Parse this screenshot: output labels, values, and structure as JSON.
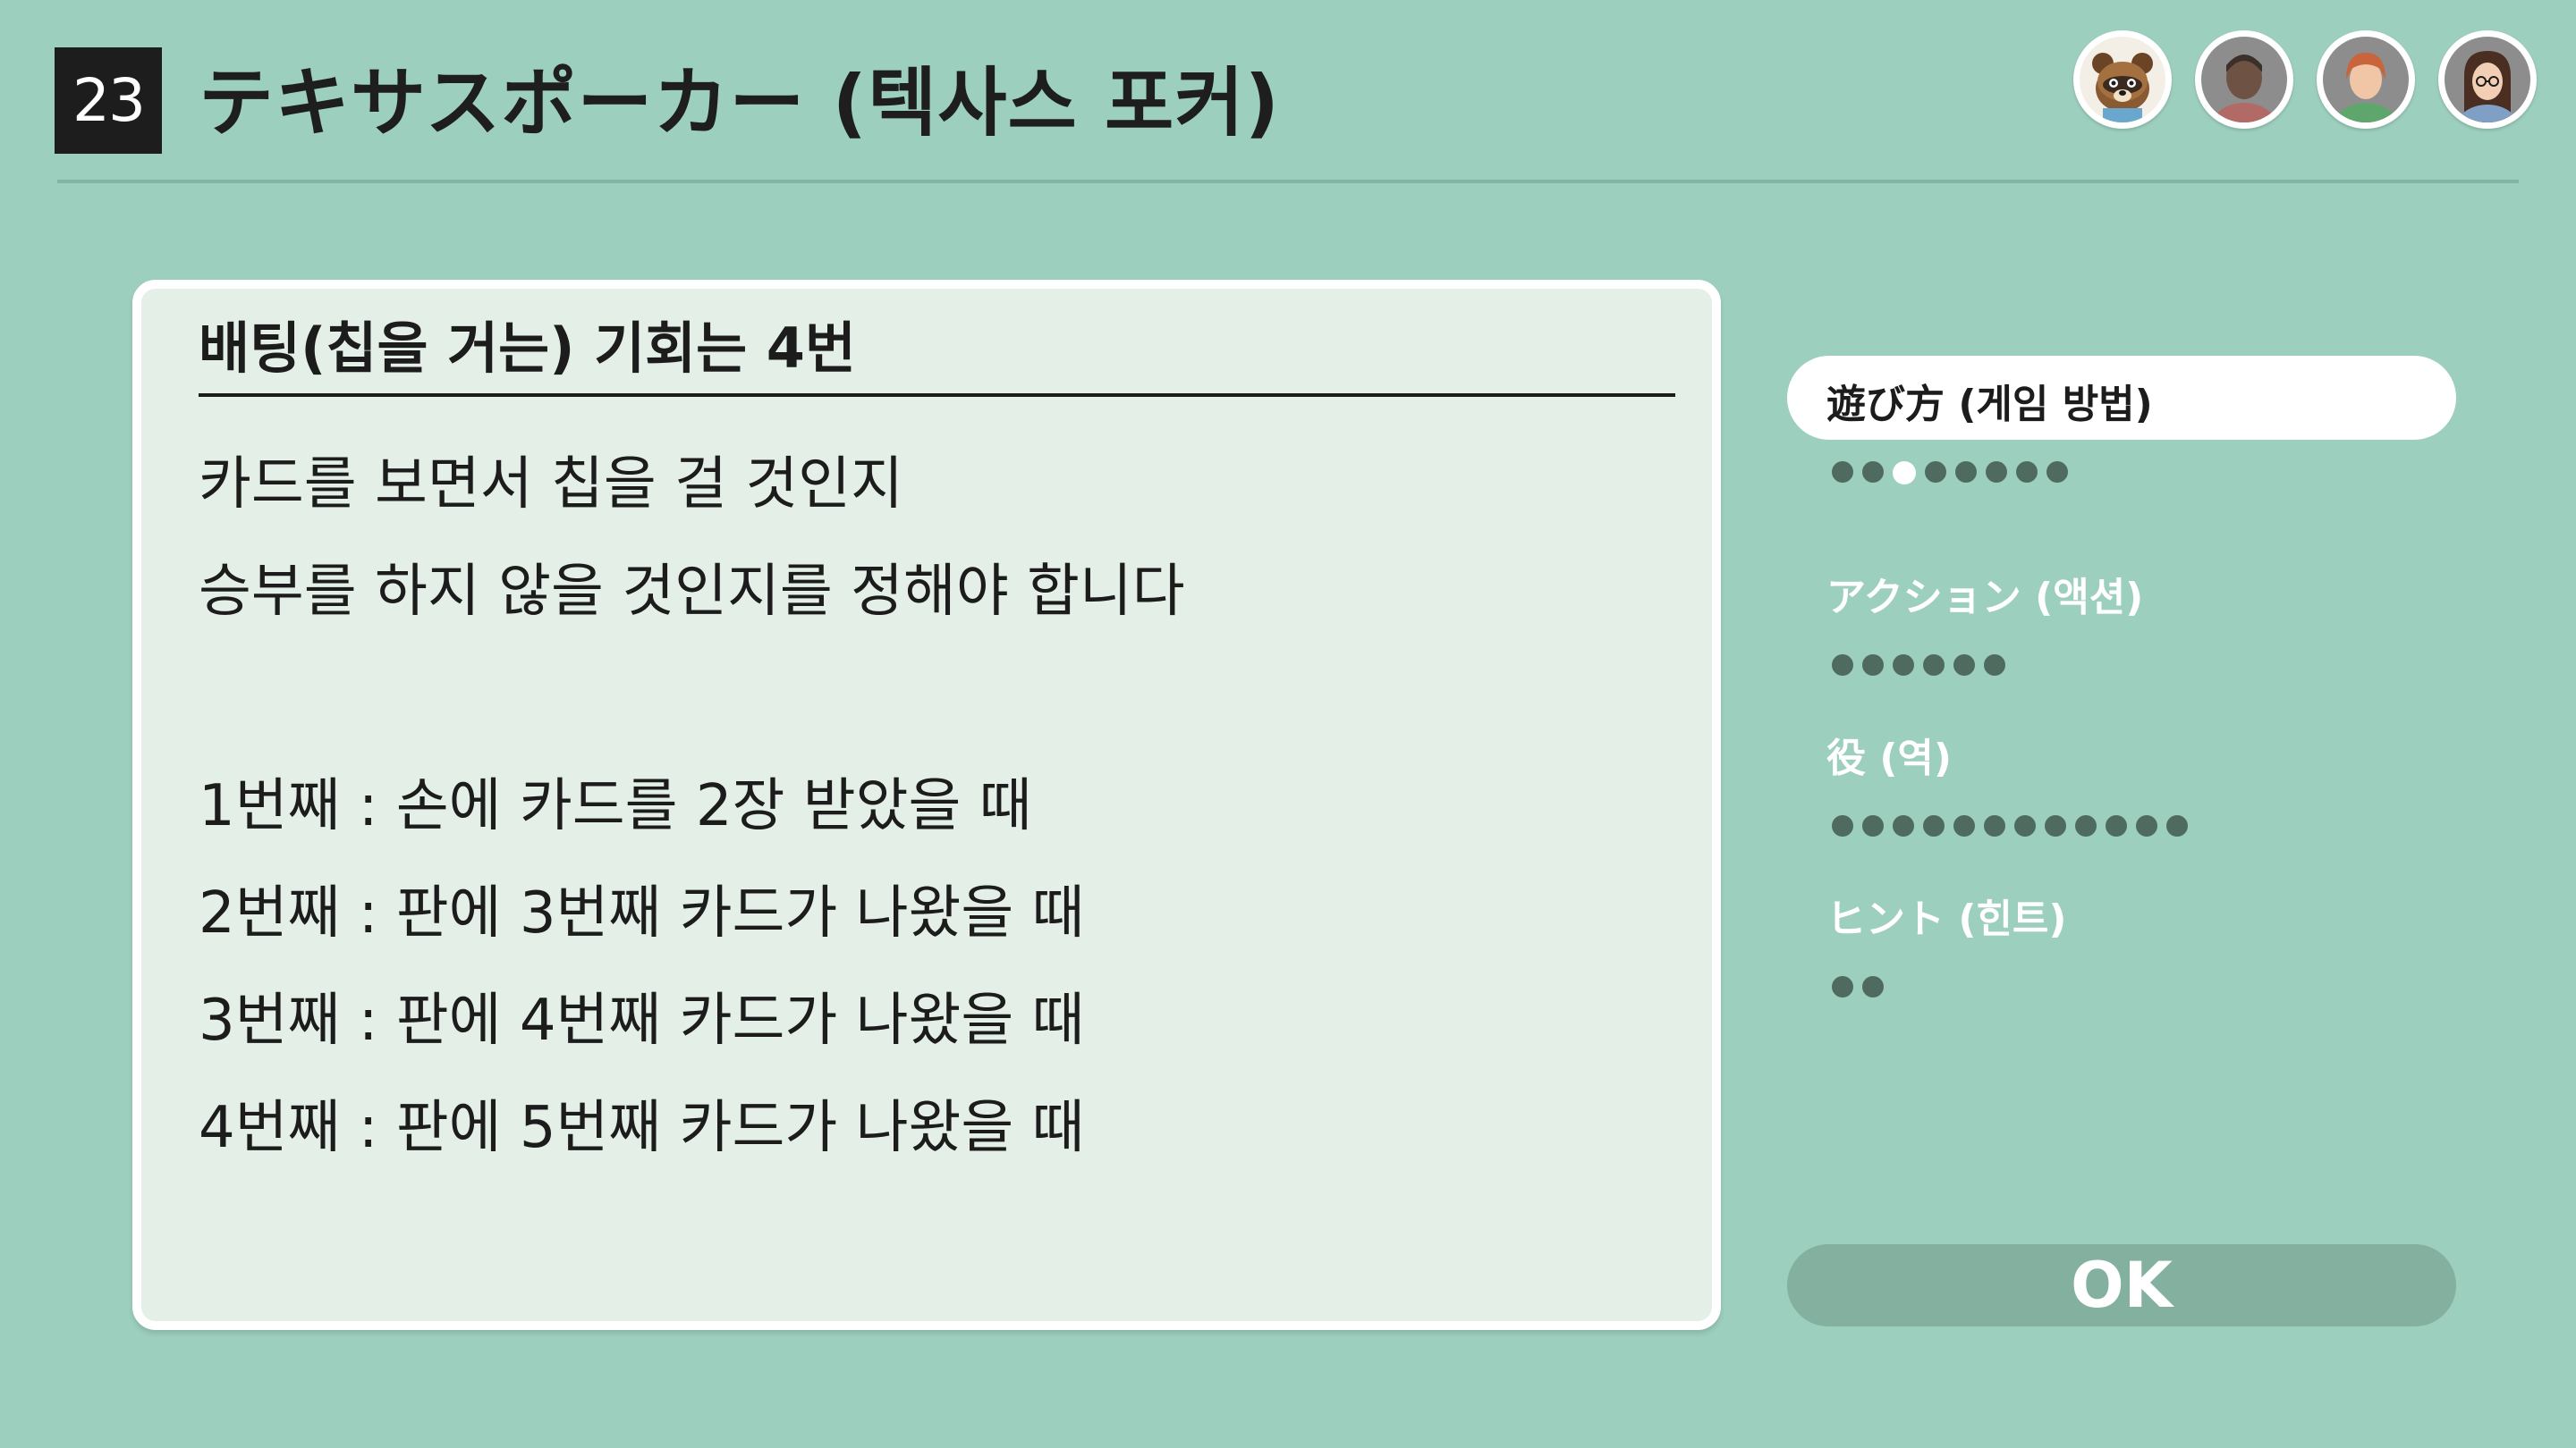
{
  "header": {
    "game_number": "23",
    "title": "テキサスポーカー (텍사스 포커)"
  },
  "players": [
    {
      "name": "tanuki-avatar",
      "icon": "raccoon-character-icon"
    },
    {
      "name": "player-avatar-2",
      "icon": "person-icon"
    },
    {
      "name": "player-avatar-3",
      "icon": "person-icon"
    },
    {
      "name": "player-avatar-4",
      "icon": "person-icon"
    }
  ],
  "content": {
    "heading": "배팅(칩을 거는) 기회는 4번",
    "lines": [
      "카드를 보면서 칩을 걸 것인지",
      "승부를 하지 않을 것인지를 정해야 합니다",
      "1번째 : 손에 카드를 2장 받았을 때",
      "2번째 : 판에 3번째 카드가 나왔을 때",
      "3번째 : 판에 4번째 카드가 나왔을 때",
      "4번째 : 판에 5번째 카드가 나왔을 때"
    ]
  },
  "sidebar": {
    "sections": [
      {
        "label": "遊び方 (게임 방법)",
        "pages": 8,
        "current_page": 3,
        "active": true
      },
      {
        "label": "アクション (액션)",
        "pages": 6,
        "current_page": null,
        "active": false
      },
      {
        "label": "役 (역)",
        "pages": 12,
        "current_page": null,
        "active": false
      },
      {
        "label": "ヒント (힌트)",
        "pages": 2,
        "current_page": null,
        "active": false
      }
    ]
  },
  "ok_button": {
    "label": "OK"
  },
  "colors": {
    "background": "#9dcfbe",
    "panel": "#e4f0e7",
    "dot_inactive": "#4f6b60",
    "ok_button": "#84b19f"
  }
}
